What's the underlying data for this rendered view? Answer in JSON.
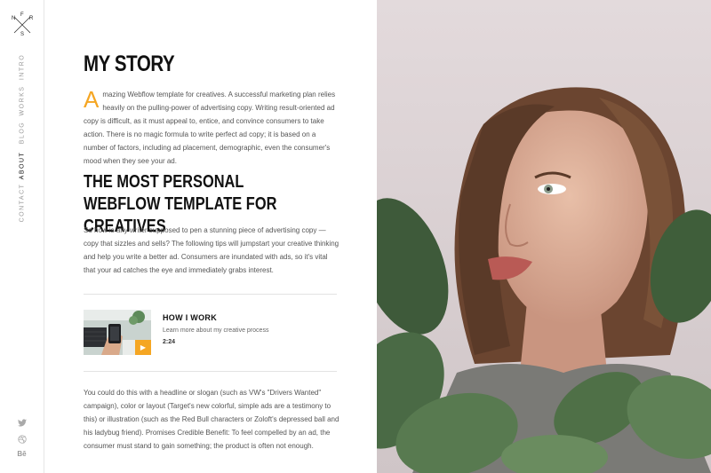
{
  "logo": {
    "letters": [
      "N",
      "F",
      "R",
      "S"
    ]
  },
  "nav": {
    "items": [
      {
        "label": "INTRO",
        "active": false
      },
      {
        "label": "WORKS",
        "active": false
      },
      {
        "label": "BLOG",
        "active": false
      },
      {
        "label": "ABOUT",
        "active": true
      },
      {
        "label": "CONTACT",
        "active": false
      }
    ]
  },
  "social": {
    "twitter_icon": "twitter-icon",
    "dribbble_icon": "dribbble-icon",
    "behance_label": "Bē"
  },
  "story": {
    "title": "MY STORY",
    "dropcap": "A",
    "intro": "mazing Webflow template for creatives. A successful marketing plan relies heavily on the pulling-power of advertising copy. Writing result-oriented ad copy is difficult, as it must appeal to, entice, and convince consumers to take action. There is no magic formula to write perfect ad copy; it is based on a number of factors, including ad placement, demographic, even the consumer's mood when they see your ad."
  },
  "section": {
    "title": "THE MOST PERSONAL WEBFLOW TEMPLATE FOR CREATIVES",
    "paragraph": "So how is any writer supposed to pen a stunning piece of advertising copy — copy that sizzles and sells? The following tips will jumpstart your creative thinking and help you write a better ad. Consumers are inundated with ads, so it's vital that your ad catches the eye and immediately grabs interest."
  },
  "video": {
    "title": "HOW I WORK",
    "subtitle": "Learn more about my creative process",
    "duration": "2:24",
    "play_icon": "play-icon"
  },
  "closing": {
    "paragraph": "You could do this with a headline or slogan (such as VW's \"Drivers Wanted\" campaign), color or layout (Target's new colorful, simple ads are a testimony to this) or illustration (such as the Red Bull characters or Zoloft's depressed ball and his ladybug friend). Promises Credible Benefit: To feel compelled by an ad, the consumer must stand to gain something; the product is often not enough."
  },
  "colors": {
    "accent": "#f5a623",
    "text": "#555555",
    "heading": "#111111"
  }
}
